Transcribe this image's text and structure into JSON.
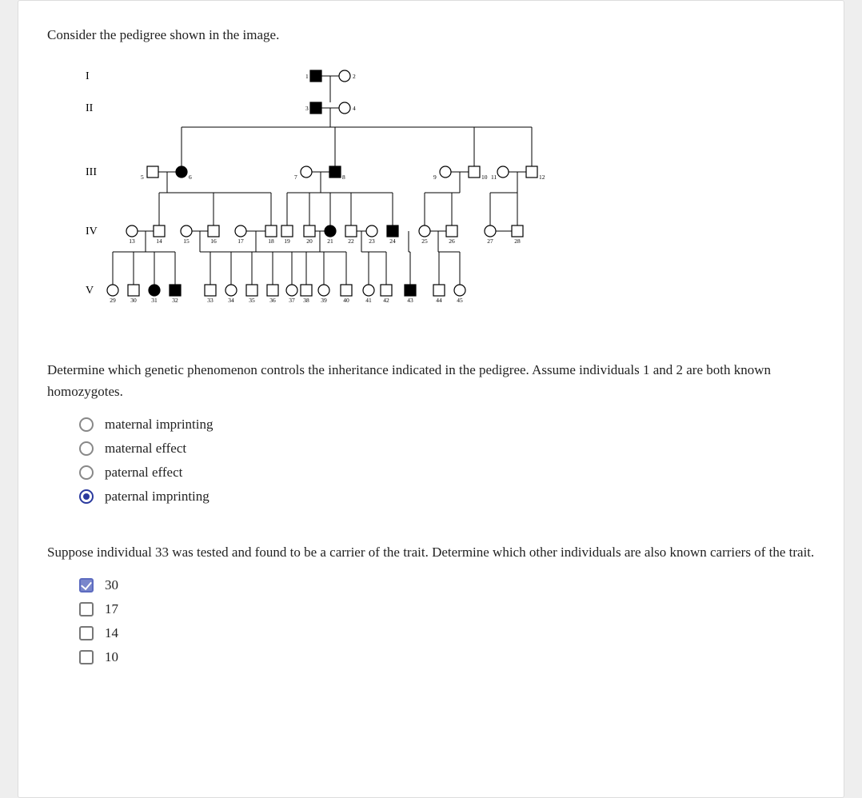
{
  "prompt": "Consider the pedigree shown in the image.",
  "question1": "Determine which genetic phenomenon controls the inheritance indicated in the pedigree. Assume individuals 1 and 2 are both known homozygotes.",
  "q1_options": [
    {
      "label": "maternal imprinting",
      "selected": false
    },
    {
      "label": "maternal effect",
      "selected": false
    },
    {
      "label": "paternal effect",
      "selected": false
    },
    {
      "label": "paternal imprinting",
      "selected": true
    }
  ],
  "question2": "Suppose individual 33 was tested and found to be a carrier of the trait. Determine which other individuals are also known carriers of the trait.",
  "q2_options": [
    {
      "label": "30",
      "checked": true
    },
    {
      "label": "17",
      "checked": false
    },
    {
      "label": "14",
      "checked": false
    },
    {
      "label": "10",
      "checked": false
    }
  ],
  "pedigree": {
    "gen_labels": [
      "I",
      "II",
      "III",
      "IV",
      "V"
    ],
    "people": {
      "1": {
        "s": "sq",
        "a": true
      },
      "2": {
        "s": "ci",
        "a": false
      },
      "3": {
        "s": "sq",
        "a": true
      },
      "4": {
        "s": "ci",
        "a": false
      },
      "5": {
        "s": "sq",
        "a": false
      },
      "6": {
        "s": "ci",
        "a": true
      },
      "7": {
        "s": "ci",
        "a": false
      },
      "8": {
        "s": "sq",
        "a": true
      },
      "9": {
        "s": "ci",
        "a": false
      },
      "10": {
        "s": "sq",
        "a": false
      },
      "11": {
        "s": "ci",
        "a": false
      },
      "12": {
        "s": "sq",
        "a": false
      },
      "13": {
        "s": "ci",
        "a": false
      },
      "14": {
        "s": "sq",
        "a": false
      },
      "15": {
        "s": "ci",
        "a": false
      },
      "16": {
        "s": "sq",
        "a": false
      },
      "17": {
        "s": "ci",
        "a": false
      },
      "18": {
        "s": "sq",
        "a": false
      },
      "19": {
        "s": "sq",
        "a": false
      },
      "20": {
        "s": "sq",
        "a": false
      },
      "21": {
        "s": "ci",
        "a": true
      },
      "22": {
        "s": "sq",
        "a": false
      },
      "23": {
        "s": "ci",
        "a": false
      },
      "24": {
        "s": "sq",
        "a": true
      },
      "25": {
        "s": "ci",
        "a": false
      },
      "26": {
        "s": "sq",
        "a": false
      },
      "27": {
        "s": "ci",
        "a": false
      },
      "28": {
        "s": "sq",
        "a": false
      },
      "29": {
        "s": "ci",
        "a": false
      },
      "30": {
        "s": "sq",
        "a": false
      },
      "31": {
        "s": "ci",
        "a": true
      },
      "32": {
        "s": "sq",
        "a": true
      },
      "33": {
        "s": "sq",
        "a": false
      },
      "34": {
        "s": "ci",
        "a": false
      },
      "35": {
        "s": "sq",
        "a": false
      },
      "36": {
        "s": "sq",
        "a": false
      },
      "37": {
        "s": "ci",
        "a": false
      },
      "38": {
        "s": "sq",
        "a": false
      },
      "39": {
        "s": "ci",
        "a": false
      },
      "40": {
        "s": "sq",
        "a": false
      },
      "41": {
        "s": "ci",
        "a": false
      },
      "42": {
        "s": "sq",
        "a": false
      },
      "43": {
        "s": "sq",
        "a": true
      },
      "44": {
        "s": "sq",
        "a": false
      },
      "45": {
        "s": "ci",
        "a": false
      }
    }
  }
}
